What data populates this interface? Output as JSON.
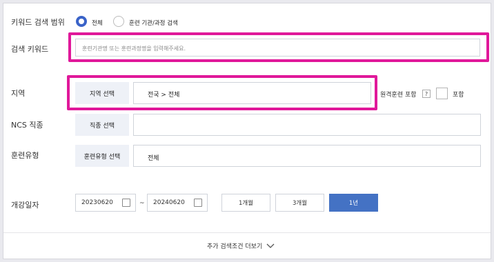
{
  "keyword_scope": {
    "label": "키워드 검색 범위",
    "options": [
      {
        "label": "전체",
        "selected": true
      },
      {
        "label": "훈련 기관/과정 검색",
        "selected": false
      }
    ]
  },
  "keyword": {
    "label": "검색 키워드",
    "placeholder": "훈련기관명 또는 훈련과정명을 입력해주세요."
  },
  "region": {
    "label": "지역",
    "button_label": "지역 선택",
    "value": "전국 > 전체",
    "remote_label": "원격훈련 포함",
    "help_icon": "?",
    "include_label": "포함"
  },
  "ncs": {
    "label": "NCS 직종",
    "button_label": "직종 선택",
    "value": ""
  },
  "training_type": {
    "label": "훈련유형",
    "button_label": "훈련유형 선택",
    "value": "전체"
  },
  "start_date": {
    "label": "개강일자",
    "from": "20230620",
    "separator": "~",
    "to": "20240620",
    "periods": [
      {
        "label": "1개월",
        "active": false
      },
      {
        "label": "3개월",
        "active": false
      },
      {
        "label": "1년",
        "active": true
      }
    ]
  },
  "more_conditions": {
    "label": "추가 검색조건 더보기",
    "icon": "chevron-down-icon"
  },
  "colors": {
    "accent": "#3a63c8",
    "active_button": "#4472c4",
    "highlight": "#e0189a",
    "select_button_bg": "#eef1f7"
  }
}
